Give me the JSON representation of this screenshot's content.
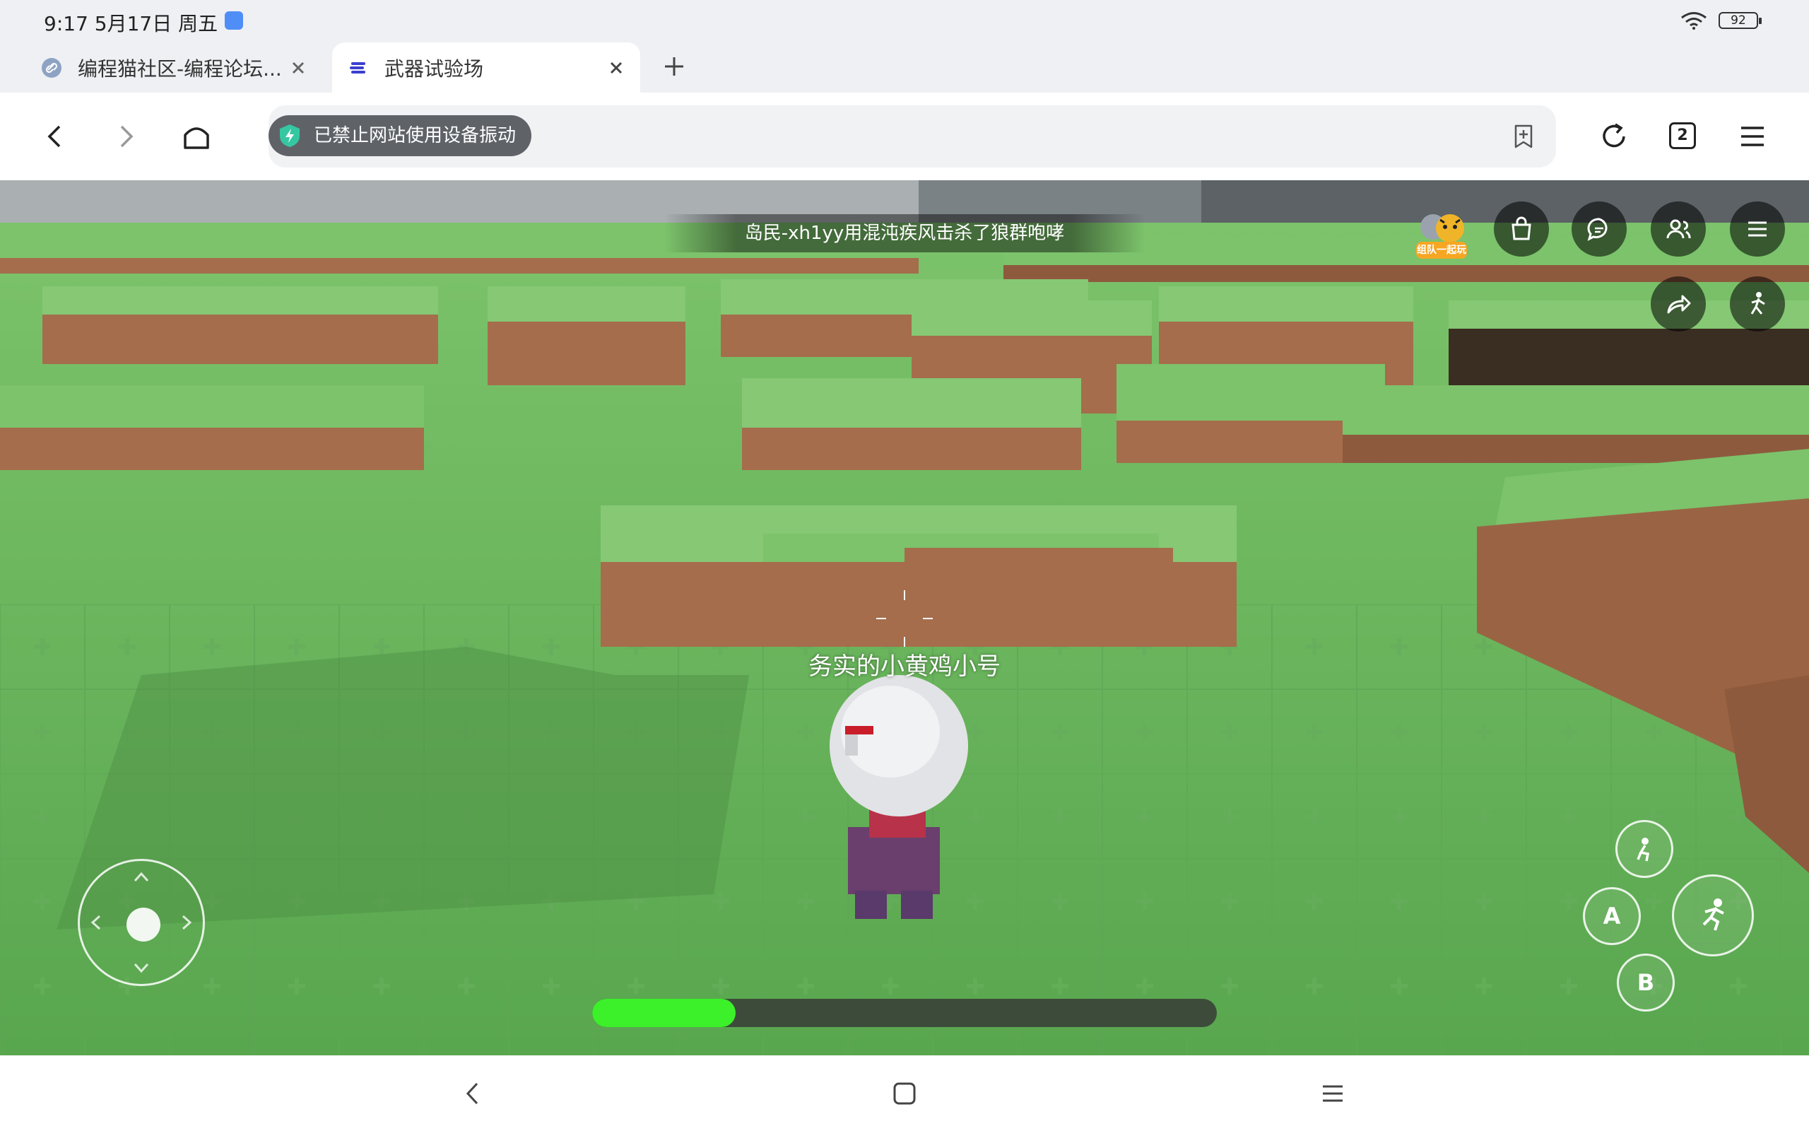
{
  "status_bar": {
    "time": "9:17 5月17日 周五",
    "battery": "92"
  },
  "tabs": [
    {
      "label": "编程猫社区-编程论坛...",
      "active": false,
      "icon": "link-icon"
    },
    {
      "label": "武器试验场",
      "active": true,
      "icon": "codemao-logo-icon"
    }
  ],
  "toolbar": {
    "notice": "已禁止网站使用设备振动",
    "tab_count": "2"
  },
  "game": {
    "kill_feed": "岛民-xh1yy用混沌疾风击杀了狼群咆哮",
    "player_name": "务实的小黄鸡小号",
    "team_badge_label": "组队一起玩",
    "buttons": {
      "a": "A",
      "b": "B"
    },
    "health_fraction": 0.23,
    "colors": {
      "health": "#3cf02a",
      "grass": "#6cb35e",
      "dirt": "#a56d4c"
    }
  }
}
